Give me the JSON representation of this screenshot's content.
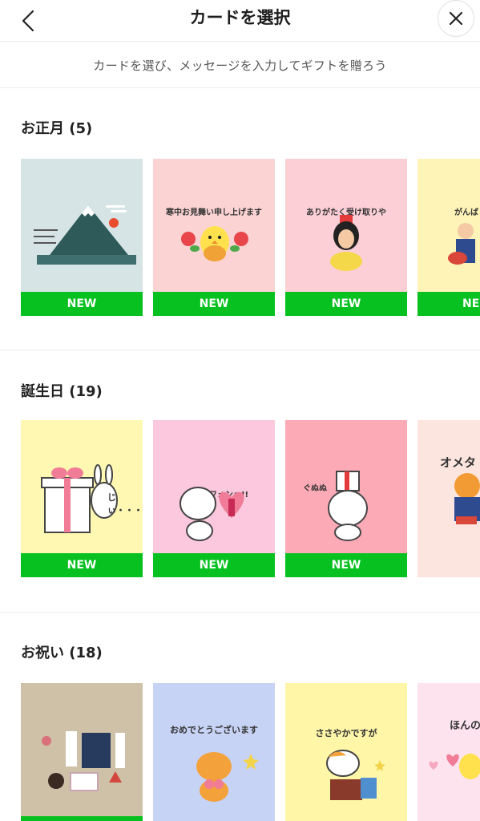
{
  "header": {
    "title": "カードを選択",
    "back_icon": "chevron-left-icon",
    "close_icon": "close-icon"
  },
  "subtitle": "カードを選び、メッセージを入力してギフトを贈ろう",
  "colors": {
    "badge_green": "#06c11f",
    "divider": "#ececec"
  },
  "sections": [
    {
      "title": "お正月 (5)",
      "cards": [
        {
          "background": "#d6e4e6",
          "caption": "",
          "badge": "NEW"
        },
        {
          "background": "#fbd3d3",
          "caption": "寒中お見舞い申し上げます",
          "badge": "NEW"
        },
        {
          "background": "#fccfd7",
          "caption": "ありがたく受け取りや",
          "badge": "NEW"
        },
        {
          "background": "#fff4b8",
          "caption": "がんば",
          "badge": "NE"
        }
      ]
    },
    {
      "title": "誕生日 (19)",
      "cards": [
        {
          "background": "#fff8b3",
          "caption": "じぃ・・・",
          "badge": "NEW"
        },
        {
          "background": "#fbc8de",
          "caption": "フォンッ!!",
          "badge": "NEW"
        },
        {
          "background": "#fbaab6",
          "caption": "ぐぬぬ",
          "badge": "NEW"
        },
        {
          "background": "#fde5df",
          "caption": "オメタ",
          "badge": ""
        }
      ]
    },
    {
      "title": "お祝い (18)",
      "cards": [
        {
          "background": "#cfc0a8",
          "caption": "",
          "badge": ""
        },
        {
          "background": "#c7d3f5",
          "caption": "おめでとうございます",
          "badge": ""
        },
        {
          "background": "#fff6a8",
          "caption": "ささやかですが",
          "badge": ""
        },
        {
          "background": "#fde3ee",
          "caption": "ほんの",
          "badge": ""
        }
      ]
    }
  ]
}
